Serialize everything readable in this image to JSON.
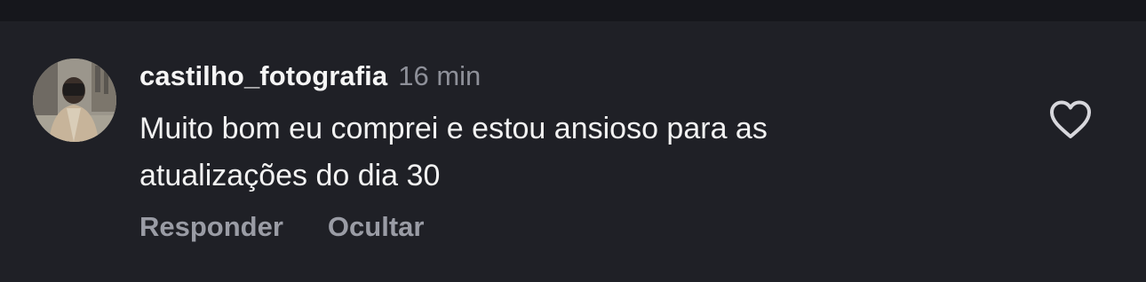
{
  "comment": {
    "username": "castilho_fotografia",
    "time": "16 min",
    "text_line1": "Muito bom eu comprei e estou ansioso para as",
    "text_line2": "atualizações do dia 30",
    "actions": {
      "reply_label": "Responder",
      "hide_label": "Ocultar"
    },
    "like_icon": "heart-outline-icon"
  },
  "colors": {
    "background": "#1f2026",
    "topbar": "#16171c",
    "username": "#f5f5f5",
    "muted": "#8e9099",
    "action": "#9a9ca5",
    "icon": "#d7d7dc"
  }
}
